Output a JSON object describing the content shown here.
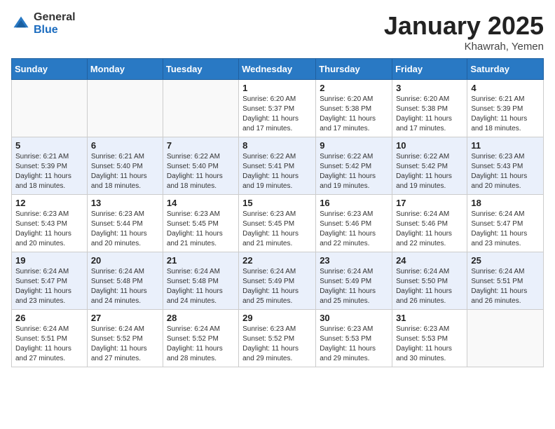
{
  "header": {
    "logo_general": "General",
    "logo_blue": "Blue",
    "month_title": "January 2025",
    "location": "Khawrah, Yemen"
  },
  "weekdays": [
    "Sunday",
    "Monday",
    "Tuesday",
    "Wednesday",
    "Thursday",
    "Friday",
    "Saturday"
  ],
  "weeks": [
    [
      {
        "day": "",
        "sunrise": "",
        "sunset": "",
        "daylight": ""
      },
      {
        "day": "",
        "sunrise": "",
        "sunset": "",
        "daylight": ""
      },
      {
        "day": "",
        "sunrise": "",
        "sunset": "",
        "daylight": ""
      },
      {
        "day": "1",
        "sunrise": "Sunrise: 6:20 AM",
        "sunset": "Sunset: 5:37 PM",
        "daylight": "Daylight: 11 hours and 17 minutes."
      },
      {
        "day": "2",
        "sunrise": "Sunrise: 6:20 AM",
        "sunset": "Sunset: 5:38 PM",
        "daylight": "Daylight: 11 hours and 17 minutes."
      },
      {
        "day": "3",
        "sunrise": "Sunrise: 6:20 AM",
        "sunset": "Sunset: 5:38 PM",
        "daylight": "Daylight: 11 hours and 17 minutes."
      },
      {
        "day": "4",
        "sunrise": "Sunrise: 6:21 AM",
        "sunset": "Sunset: 5:39 PM",
        "daylight": "Daylight: 11 hours and 18 minutes."
      }
    ],
    [
      {
        "day": "5",
        "sunrise": "Sunrise: 6:21 AM",
        "sunset": "Sunset: 5:39 PM",
        "daylight": "Daylight: 11 hours and 18 minutes."
      },
      {
        "day": "6",
        "sunrise": "Sunrise: 6:21 AM",
        "sunset": "Sunset: 5:40 PM",
        "daylight": "Daylight: 11 hours and 18 minutes."
      },
      {
        "day": "7",
        "sunrise": "Sunrise: 6:22 AM",
        "sunset": "Sunset: 5:40 PM",
        "daylight": "Daylight: 11 hours and 18 minutes."
      },
      {
        "day": "8",
        "sunrise": "Sunrise: 6:22 AM",
        "sunset": "Sunset: 5:41 PM",
        "daylight": "Daylight: 11 hours and 19 minutes."
      },
      {
        "day": "9",
        "sunrise": "Sunrise: 6:22 AM",
        "sunset": "Sunset: 5:42 PM",
        "daylight": "Daylight: 11 hours and 19 minutes."
      },
      {
        "day": "10",
        "sunrise": "Sunrise: 6:22 AM",
        "sunset": "Sunset: 5:42 PM",
        "daylight": "Daylight: 11 hours and 19 minutes."
      },
      {
        "day": "11",
        "sunrise": "Sunrise: 6:23 AM",
        "sunset": "Sunset: 5:43 PM",
        "daylight": "Daylight: 11 hours and 20 minutes."
      }
    ],
    [
      {
        "day": "12",
        "sunrise": "Sunrise: 6:23 AM",
        "sunset": "Sunset: 5:43 PM",
        "daylight": "Daylight: 11 hours and 20 minutes."
      },
      {
        "day": "13",
        "sunrise": "Sunrise: 6:23 AM",
        "sunset": "Sunset: 5:44 PM",
        "daylight": "Daylight: 11 hours and 20 minutes."
      },
      {
        "day": "14",
        "sunrise": "Sunrise: 6:23 AM",
        "sunset": "Sunset: 5:45 PM",
        "daylight": "Daylight: 11 hours and 21 minutes."
      },
      {
        "day": "15",
        "sunrise": "Sunrise: 6:23 AM",
        "sunset": "Sunset: 5:45 PM",
        "daylight": "Daylight: 11 hours and 21 minutes."
      },
      {
        "day": "16",
        "sunrise": "Sunrise: 6:23 AM",
        "sunset": "Sunset: 5:46 PM",
        "daylight": "Daylight: 11 hours and 22 minutes."
      },
      {
        "day": "17",
        "sunrise": "Sunrise: 6:24 AM",
        "sunset": "Sunset: 5:46 PM",
        "daylight": "Daylight: 11 hours and 22 minutes."
      },
      {
        "day": "18",
        "sunrise": "Sunrise: 6:24 AM",
        "sunset": "Sunset: 5:47 PM",
        "daylight": "Daylight: 11 hours and 23 minutes."
      }
    ],
    [
      {
        "day": "19",
        "sunrise": "Sunrise: 6:24 AM",
        "sunset": "Sunset: 5:47 PM",
        "daylight": "Daylight: 11 hours and 23 minutes."
      },
      {
        "day": "20",
        "sunrise": "Sunrise: 6:24 AM",
        "sunset": "Sunset: 5:48 PM",
        "daylight": "Daylight: 11 hours and 24 minutes."
      },
      {
        "day": "21",
        "sunrise": "Sunrise: 6:24 AM",
        "sunset": "Sunset: 5:48 PM",
        "daylight": "Daylight: 11 hours and 24 minutes."
      },
      {
        "day": "22",
        "sunrise": "Sunrise: 6:24 AM",
        "sunset": "Sunset: 5:49 PM",
        "daylight": "Daylight: 11 hours and 25 minutes."
      },
      {
        "day": "23",
        "sunrise": "Sunrise: 6:24 AM",
        "sunset": "Sunset: 5:49 PM",
        "daylight": "Daylight: 11 hours and 25 minutes."
      },
      {
        "day": "24",
        "sunrise": "Sunrise: 6:24 AM",
        "sunset": "Sunset: 5:50 PM",
        "daylight": "Daylight: 11 hours and 26 minutes."
      },
      {
        "day": "25",
        "sunrise": "Sunrise: 6:24 AM",
        "sunset": "Sunset: 5:51 PM",
        "daylight": "Daylight: 11 hours and 26 minutes."
      }
    ],
    [
      {
        "day": "26",
        "sunrise": "Sunrise: 6:24 AM",
        "sunset": "Sunset: 5:51 PM",
        "daylight": "Daylight: 11 hours and 27 minutes."
      },
      {
        "day": "27",
        "sunrise": "Sunrise: 6:24 AM",
        "sunset": "Sunset: 5:52 PM",
        "daylight": "Daylight: 11 hours and 27 minutes."
      },
      {
        "day": "28",
        "sunrise": "Sunrise: 6:24 AM",
        "sunset": "Sunset: 5:52 PM",
        "daylight": "Daylight: 11 hours and 28 minutes."
      },
      {
        "day": "29",
        "sunrise": "Sunrise: 6:23 AM",
        "sunset": "Sunset: 5:52 PM",
        "daylight": "Daylight: 11 hours and 29 minutes."
      },
      {
        "day": "30",
        "sunrise": "Sunrise: 6:23 AM",
        "sunset": "Sunset: 5:53 PM",
        "daylight": "Daylight: 11 hours and 29 minutes."
      },
      {
        "day": "31",
        "sunrise": "Sunrise: 6:23 AM",
        "sunset": "Sunset: 5:53 PM",
        "daylight": "Daylight: 11 hours and 30 minutes."
      },
      {
        "day": "",
        "sunrise": "",
        "sunset": "",
        "daylight": ""
      }
    ]
  ]
}
